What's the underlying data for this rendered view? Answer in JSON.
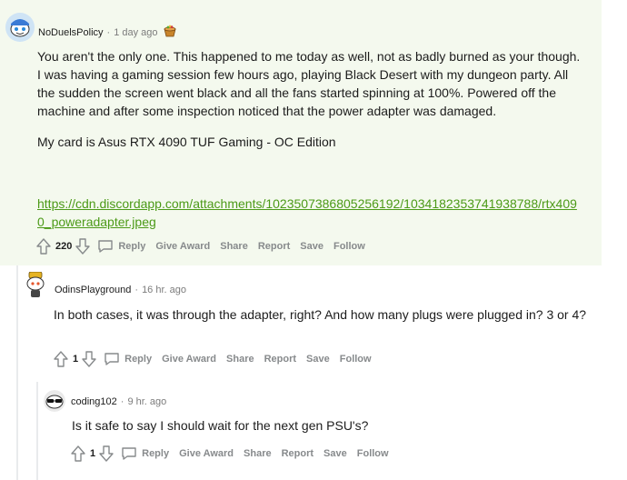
{
  "comments": [
    {
      "author": "NoDuelsPolicy",
      "time": "1 day ago",
      "paragraphs": [
        "You aren't the only one. This happened to me today as well, not as badly burned as your though. I was having a gaming session few hours ago, playing Black Desert with my dungeon party. All the sudden the screen went black and all the fans started spinning at 100%. Powered off the machine and after some inspection noticed that the power adapter was damaged.",
        "My card is Asus RTX 4090 TUF Gaming - OC Edition"
      ],
      "link": "https://cdn.discordapp.com/attachments/1023507386805256192/1034182353741938788/rtx4090_poweradapter.jpeg",
      "votes": "220"
    },
    {
      "author": "OdinsPlayground",
      "time": "16 hr. ago",
      "paragraphs": [
        "In both cases, it was through the adapter, right? And how many plugs were plugged in? 3 or 4?"
      ],
      "votes": "1"
    },
    {
      "author": "coding102",
      "time": "9 hr. ago",
      "paragraphs": [
        "Is it safe to say I should wait for the next gen PSU's?"
      ],
      "votes": "1"
    }
  ],
  "actions": {
    "reply": "Reply",
    "give_award": "Give Award",
    "share": "Share",
    "report": "Report",
    "save": "Save",
    "follow": "Follow"
  },
  "colors": {
    "highlight_bg": "#f4f9ee",
    "link": "#4c9a18",
    "meta": "#7c7c7c",
    "action": "#878a8c"
  },
  "icons": [
    "upvote-icon",
    "downvote-icon",
    "reply-bubble-icon",
    "award-icon"
  ]
}
